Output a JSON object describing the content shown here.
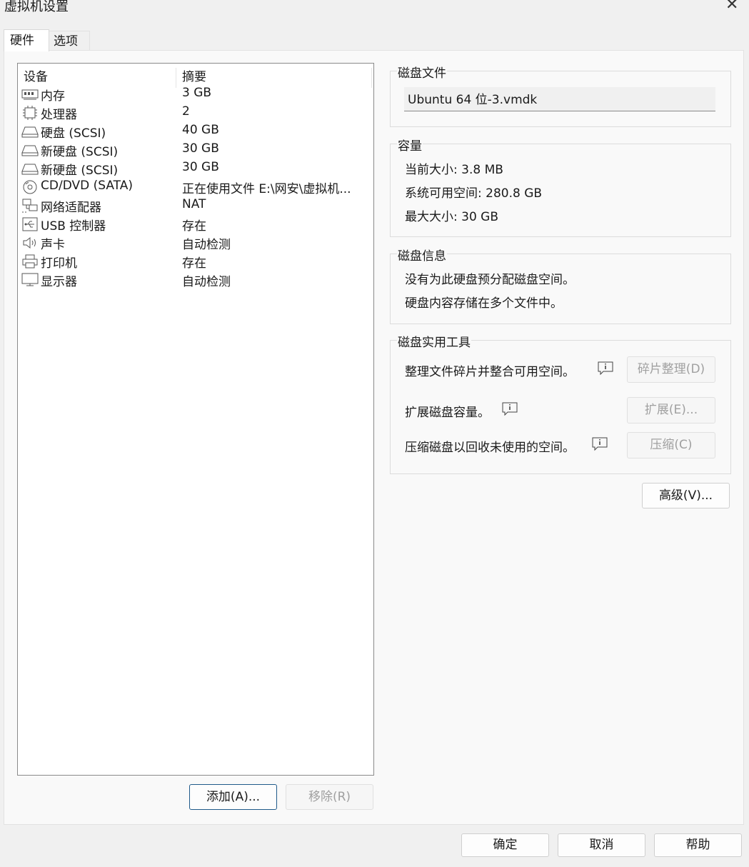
{
  "window": {
    "title": "虚拟机设置",
    "close_glyph": "✕"
  },
  "tabs": [
    {
      "label": "硬件"
    },
    {
      "label": "选项"
    }
  ],
  "device_list": {
    "header_device": "设备",
    "header_summary": "摘要",
    "rows": [
      {
        "icon": "memory-icon",
        "name": "内存",
        "summary": "3 GB"
      },
      {
        "icon": "processor-icon",
        "name": "处理器",
        "summary": "2"
      },
      {
        "icon": "hard-disk-icon",
        "name": "硬盘 (SCSI)",
        "summary": "40 GB"
      },
      {
        "icon": "hard-disk-icon",
        "name": "新硬盘 (SCSI)",
        "summary": "30 GB"
      },
      {
        "icon": "hard-disk-icon",
        "name": "新硬盘 (SCSI)",
        "summary": "30 GB"
      },
      {
        "icon": "cd-dvd-icon",
        "name": "CD/DVD (SATA)",
        "summary": "正在使用文件 E:\\网安\\虚拟机..."
      },
      {
        "icon": "network-adapter-icon",
        "name": "网络适配器",
        "summary": "NAT"
      },
      {
        "icon": "usb-icon",
        "name": "USB 控制器",
        "summary": "存在"
      },
      {
        "icon": "speaker-icon",
        "name": "声卡",
        "summary": "自动检测"
      },
      {
        "icon": "printer-icon",
        "name": "打印机",
        "summary": "存在"
      },
      {
        "icon": "monitor-icon",
        "name": "显示器",
        "summary": "自动检测"
      }
    ]
  },
  "list_buttons": {
    "add": "添加(A)...",
    "remove": "移除(R)"
  },
  "disk_file": {
    "label": "磁盘文件",
    "value": "Ubuntu 64 位-3.vmdk"
  },
  "capacity": {
    "label": "容量",
    "current_size": "当前大小: 3.8 MB",
    "available_space": "系统可用空间: 280.8 GB",
    "max_size": "最大大小: 30 GB"
  },
  "disk_info": {
    "label": "磁盘信息",
    "line1": "没有为此硬盘预分配磁盘空间。",
    "line2": "硬盘内容存储在多个文件中。"
  },
  "disk_utilities": {
    "label": "磁盘实用工具",
    "defrag_text": "整理文件碎片并整合可用空间。",
    "defrag_button": "碎片整理(D)",
    "expand_text": "扩展磁盘容量。",
    "expand_button": "扩展(E)...",
    "compact_text": "压缩磁盘以回收未使用的空间。",
    "compact_button": "压缩(C)"
  },
  "advanced_button": "高级(V)...",
  "footer": {
    "ok": "确定",
    "cancel": "取消",
    "help": "帮助"
  }
}
